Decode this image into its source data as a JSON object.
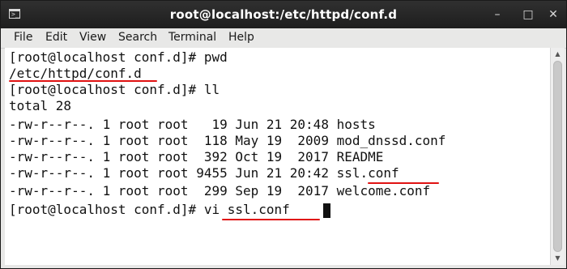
{
  "window": {
    "title": "root@localhost:/etc/httpd/conf.d",
    "icon": "terminal-icon",
    "minimize_symbol": "–",
    "maximize_symbol": "□",
    "close_symbol": "✕"
  },
  "menu": {
    "items": [
      "File",
      "Edit",
      "View",
      "Search",
      "Terminal",
      "Help"
    ]
  },
  "terminal": {
    "lines": [
      "[root@localhost conf.d]# pwd",
      "/etc/httpd/conf.d",
      "[root@localhost conf.d]# ll",
      "total 28",
      "-rw-r--r--. 1 root root   19 Jun 21 20:48 hosts",
      "-rw-r--r--. 1 root root  118 May 19  2009 mod_dnssd.conf",
      "-rw-r--r--. 1 root root  392 Oct 19  2017 README",
      "-rw-r--r--. 1 root root 9455 Jun 21 20:42 ssl.conf",
      "-rw-r--r--. 1 root root  299 Sep 19  2017 welcome.conf",
      "[root@localhost conf.d]# vi ssl.conf"
    ]
  },
  "colors": {
    "annotation_underline": "#e01212",
    "titlebar": "#262626",
    "terminal_bg": "#ffffff",
    "terminal_fg": "#111111"
  }
}
